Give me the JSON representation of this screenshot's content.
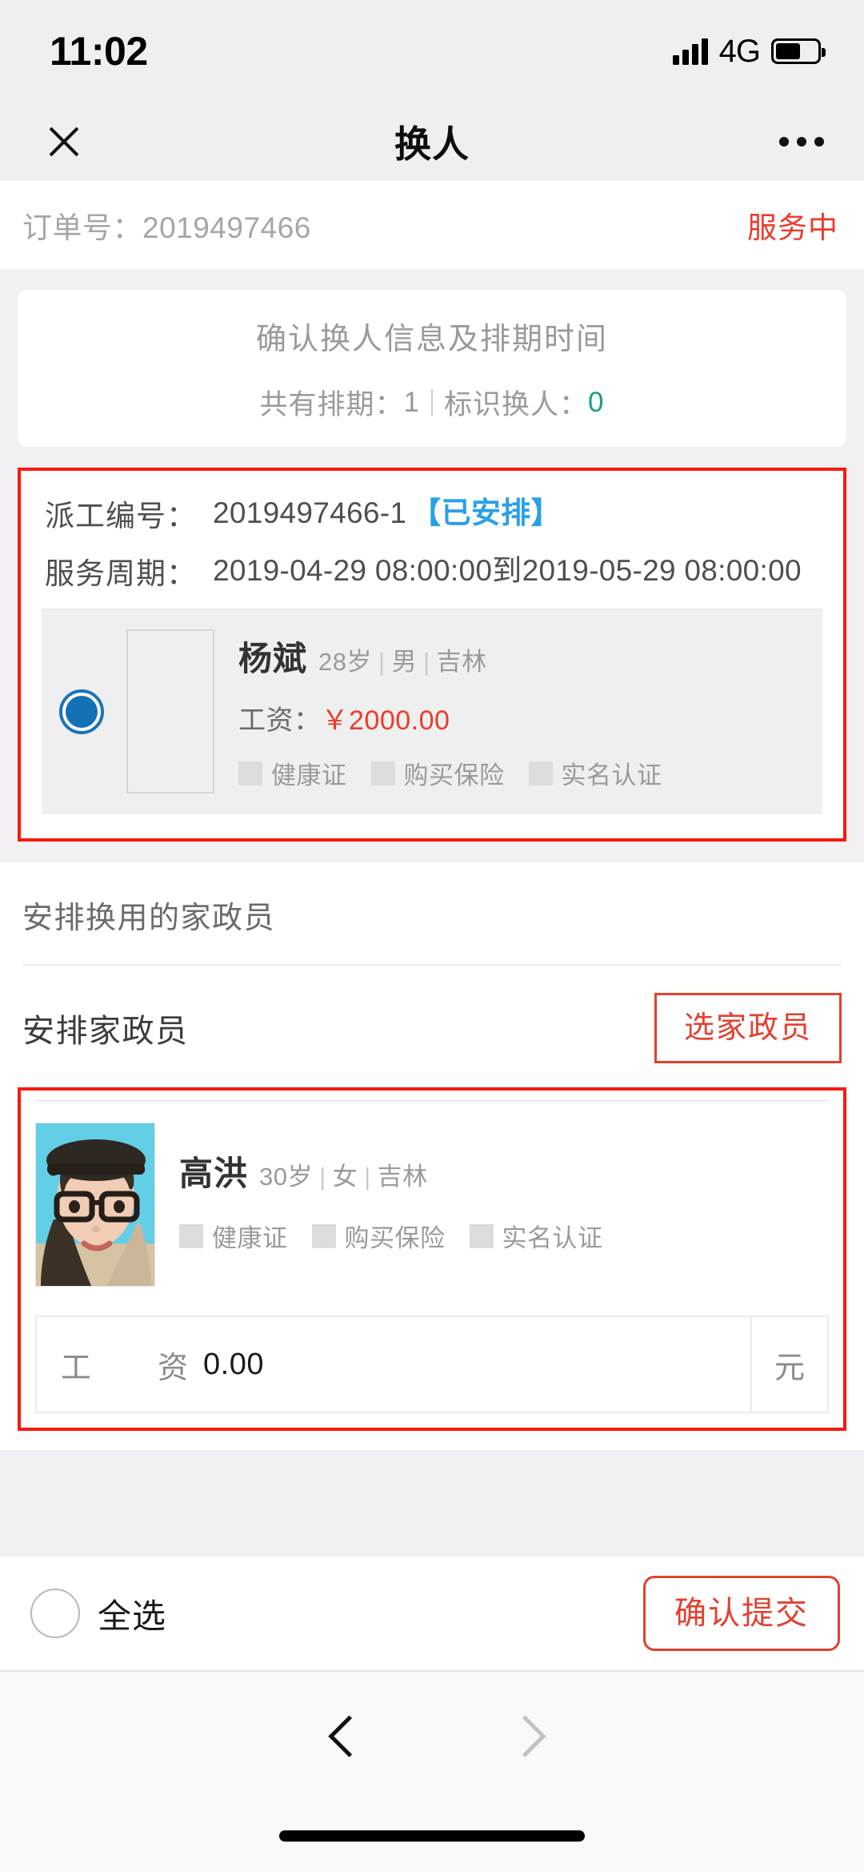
{
  "status_bar": {
    "time": "11:02",
    "network": "4G",
    "signal_icon": "signal-bars-icon",
    "battery_icon": "battery-icon"
  },
  "nav_bar": {
    "close_icon": "close-icon",
    "title": "换人",
    "more_icon": "more-dots-icon"
  },
  "order": {
    "label": "订单号：2019497466",
    "status": "服务中"
  },
  "summary": {
    "title": "确认换人信息及排期时间",
    "schedule_label": "共有排期：",
    "schedule_count": "1",
    "swap_label": "标识换人：",
    "swap_count": "0"
  },
  "dispatch": {
    "dispatch_no_key": "派工编号：",
    "dispatch_no_value": "2019497466-1",
    "dispatch_status_badge": "【已安排】",
    "period_key": "服务周期：",
    "period_value": "2019-04-29 08:00:00到2019-05-29 08:00:00",
    "worker": {
      "radio_selected": "radio-selected-icon",
      "photo": "broken-image-placeholder",
      "name": "杨斌",
      "age": "28岁",
      "gender": "男",
      "region": "吉林",
      "wage_label": "工资：",
      "wage_value": "￥2000.00",
      "tags": [
        "健康证",
        "购买保险",
        "实名认证"
      ]
    }
  },
  "assign_section": {
    "section_title": "安排换用的家政员",
    "assign_label": "安排家政员",
    "choose_button": "选家政员",
    "selected_worker": {
      "avatar": "worker-photo",
      "name": "高洪",
      "age": "30岁",
      "gender": "女",
      "region": "吉林",
      "tags": [
        "健康证",
        "购买保险",
        "实名认证"
      ]
    },
    "wage_input": {
      "label_char1": "工",
      "label_char2": "资",
      "value": "0.00",
      "placeholder": "0.00",
      "unit": "元"
    }
  },
  "bottom_bar": {
    "select_all_checkbox": "select-all-checkbox",
    "select_all_label": "全选",
    "submit_button": "确认提交"
  },
  "browser_nav": {
    "back_icon": "chevron-left-icon",
    "forward_icon": "chevron-right-icon"
  },
  "colors": {
    "accent_red": "#e2412f",
    "status_red": "#ec3b2b",
    "highlight_border_red": "#f8190b",
    "badge_blue": "#29a0e8",
    "radio_blue": "#1471b6",
    "count_green": "#16a085",
    "page_bg": "#f2f0f4"
  }
}
